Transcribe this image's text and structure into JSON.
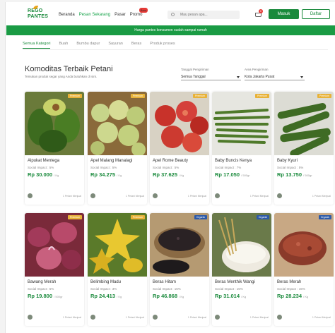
{
  "header": {
    "logo_line1": "REGO",
    "logo_line2": "PANTES",
    "nav": [
      "Beranda",
      "Pesan Sekarang",
      "Pasar",
      "Promo"
    ],
    "promo_badge": "Baru",
    "search_placeholder": "Mau pesan apa...",
    "cart_count": "0",
    "login_label": "Masuk",
    "register_label": "Daftar"
  },
  "banner": "Harga pantes konsumen sudah sampai rumah",
  "tabs": [
    "Semua Kategori",
    "Buah",
    "Bumbu dapur",
    "Sayuran",
    "Beras",
    "Produk proses"
  ],
  "section": {
    "title": "Komoditas Terbaik Petani",
    "subtitle": "Temukan produk segar yang Anda butuhkan di sini."
  },
  "filters": {
    "date_label": "Tanggal Pengiriman",
    "date_value": "Semua Tanggal",
    "area_label": "Area Pengiriman",
    "area_value": "Kota Jakarta Pusat"
  },
  "products": [
    {
      "name": "Alpukat Mentega",
      "impact": "Social Impact : 5%",
      "price": "Rp 30.000",
      "unit": "/ Kg",
      "badge": "Premium",
      "farmers": "1 Petani Menjual"
    },
    {
      "name": "Apel Malang Manalagi",
      "impact": "Social Impact : 5%",
      "price": "Rp 34.275",
      "unit": "/ Kg",
      "badge": "Premium",
      "farmers": "1 Petani Menjual"
    },
    {
      "name": "Apel Rome Beauty",
      "impact": "Social Impact : 5%",
      "price": "Rp 37.625",
      "unit": "/ Kg",
      "badge": "Premium",
      "farmers": "1 Petani Menjual"
    },
    {
      "name": "Baby Buncis Kenya",
      "impact": "Social Impact : 7%",
      "price": "Rp 17.050",
      "unit": "/ 500gr",
      "badge": "Premium",
      "farmers": "1 Petani Menjual"
    },
    {
      "name": "Baby Kyuri",
      "impact": "Social Impact : 5%",
      "price": "Rp 13.750",
      "unit": "/ 500gr",
      "badge": "Premium",
      "farmers": "1 Petani Menjual"
    },
    {
      "name": "Bawang Merah",
      "impact": "Social Impact : 5%",
      "price": "Rp 19.800",
      "unit": "/ 500gr",
      "badge": "Premium",
      "farmers": "1 Petani Menjual"
    },
    {
      "name": "Belimbing Madu",
      "impact": "Social Impact : 3%",
      "price": "Rp 24.413",
      "unit": "/ Kg",
      "badge": "Premium",
      "farmers": "1 Petani Menjual"
    },
    {
      "name": "Beras Hitam",
      "impact": "Social Impact : 15%",
      "price": "Rp 46.868",
      "unit": "/ Kg",
      "badge": "Organik",
      "farmers": "1 Petani Menjual"
    },
    {
      "name": "Beras Menthik Wangi",
      "impact": "Social Impact : 15%",
      "price": "Rp 31.014",
      "unit": "/ Kg",
      "badge": "Organik",
      "farmers": "1 Petani Menjual"
    },
    {
      "name": "Beras Merah",
      "impact": "Social Impact : 15%",
      "price": "Rp 28.234",
      "unit": "/ Kg",
      "badge": "Organik",
      "farmers": "1 Petani Menjual"
    }
  ],
  "colors": {
    "brand": "#1a8a3c",
    "banner": "#1a9b44",
    "premium": "#e8b238",
    "organik": "#2d5aa8"
  }
}
